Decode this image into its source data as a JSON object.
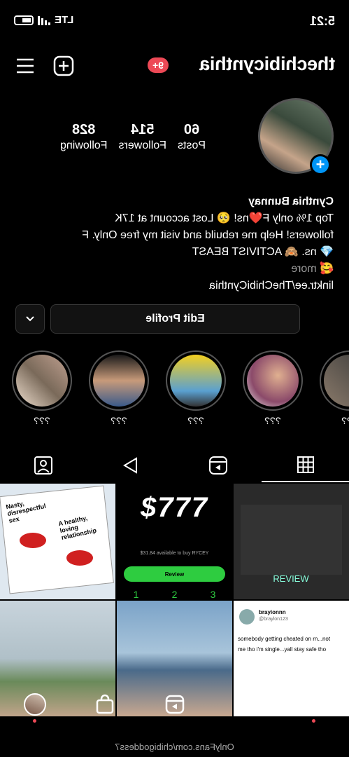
{
  "status_bar": {
    "time": "5:21",
    "network": "LTE"
  },
  "header": {
    "username": "thechibicynthia",
    "notification_count": "9+"
  },
  "profile": {
    "stats": [
      {
        "value": "60",
        "label": "Posts"
      },
      {
        "value": "514",
        "label": "Followers"
      },
      {
        "value": "828",
        "label": "Following"
      }
    ],
    "name": "Cynthia Bunnay",
    "bio_lines": [
      "Top 1% only F❤️ns! 🥺 Lost account at 17K",
      "followers! Help me rebuild and visit my free Only. F",
      "💎 ns. 🙈 ACTIVIST BEAST",
      "🥰"
    ],
    "more_label": "more",
    "link": "linktr.ee/TheChibiCynthia"
  },
  "actions": {
    "edit_profile_label": "Edit Profile"
  },
  "highlights": [
    {
      "label": "???"
    },
    {
      "label": "???"
    },
    {
      "label": "???"
    },
    {
      "label": "???"
    },
    {
      "label": "???"
    }
  ],
  "posts": [
    {
      "text_a": "Nasty, disrespectful sex",
      "text_b": "A healthy, loving relationship"
    },
    {
      "price": "$777",
      "caption": "$31.84 available to buy RYCEY",
      "button": "Review",
      "numbers": [
        "1",
        "2",
        "3"
      ]
    },
    {
      "caption": ""
    },
    {
      "caption": ""
    },
    {
      "caption": ""
    },
    {
      "handle": "brayionnn",
      "sub": "@braylon123",
      "line1": "somebody getting cheated on rn...not",
      "line2": "me tho i'm single...yall stay safe tho"
    }
  ],
  "watermark": "OnlyFans.com/chibigoddess7",
  "colors": {
    "accent": "#0095f6",
    "badge": "#ed4956",
    "background": "#000000"
  }
}
